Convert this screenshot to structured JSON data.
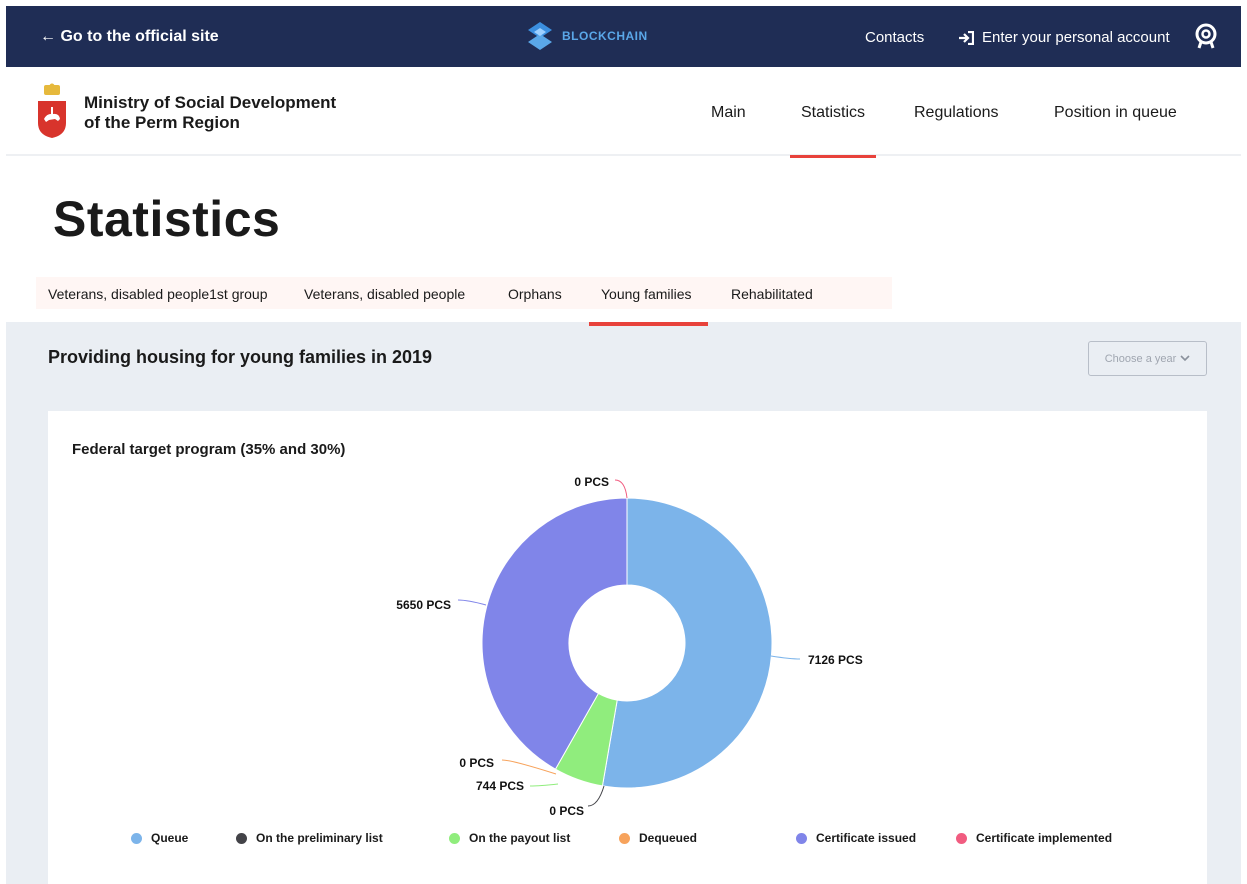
{
  "topbar": {
    "back_label": "← Go to the official site",
    "brand": "BLOCKCHAIN",
    "contacts": "Contacts",
    "enter": "Enter your personal account"
  },
  "header": {
    "ministry_line1": "Ministry of Social Development",
    "ministry_line2": "of the Perm Region",
    "nav": [
      "Main",
      "Statistics",
      "Regulations",
      "Position in queue"
    ],
    "active_nav": "Statistics"
  },
  "page": {
    "title": "Statistics",
    "tabs": [
      "Veterans, disabled people1st group",
      "Veterans, disabled people",
      "Orphans",
      "Young families",
      "Rehabilitated"
    ],
    "active_tab": "Young families",
    "section_title": "Providing housing for young families in 2019",
    "year_select": "Choose a year",
    "card_title": "Federal target program (35% and 30%)"
  },
  "colors": {
    "accent": "#e8423b",
    "topbar": "#1f2d55",
    "section_bg": "#eaeef3"
  },
  "chart_data": {
    "type": "pie",
    "title": "Federal target program (35% and 30%)",
    "unit": "PCS",
    "legend_position": "bottom",
    "series": [
      {
        "name": "Queue",
        "value": 7126,
        "color": "#7cb4ea"
      },
      {
        "name": "On the preliminary list",
        "value": 0,
        "color": "#434348"
      },
      {
        "name": "On the payout list",
        "value": 744,
        "color": "#90ed7d"
      },
      {
        "name": "Dequeued",
        "value": 0,
        "color": "#f7a35c"
      },
      {
        "name": "Certificate issued",
        "value": 5650,
        "color": "#8085e9"
      },
      {
        "name": "Certificate implemented",
        "value": 0,
        "color": "#f15c80"
      }
    ],
    "labels": [
      "7126 PCS",
      "0 PCS",
      "744 PCS",
      "0 PCS",
      "5650 PCS",
      "0 PCS"
    ]
  }
}
